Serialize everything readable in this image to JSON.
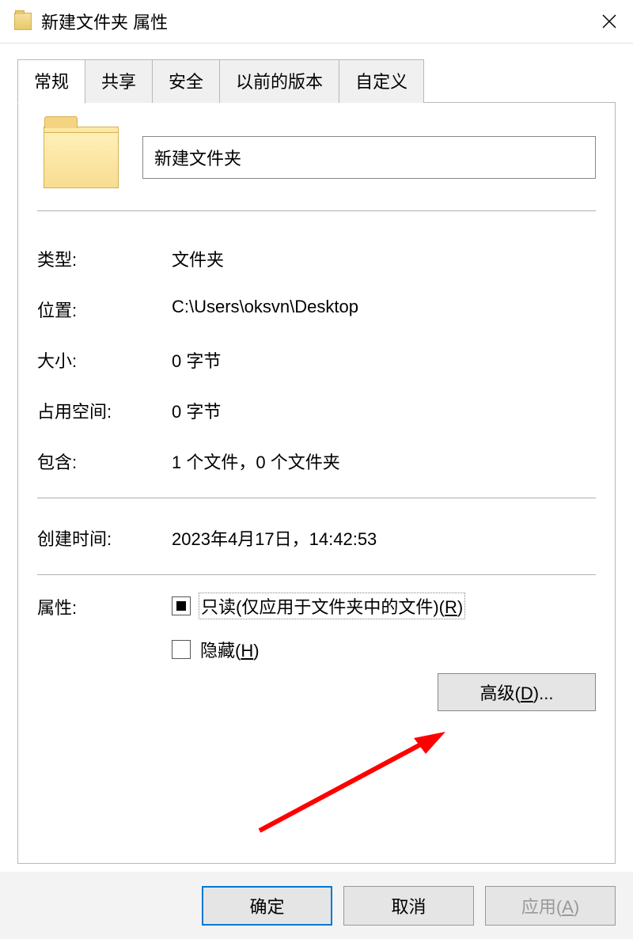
{
  "titlebar": {
    "title": "新建文件夹 属性"
  },
  "tabs": {
    "general": "常规",
    "sharing": "共享",
    "security": "安全",
    "previous_versions": "以前的版本",
    "customize": "自定义"
  },
  "general": {
    "folder_name": "新建文件夹",
    "labels": {
      "type": "类型:",
      "location": "位置:",
      "size": "大小:",
      "size_on_disk": "占用空间:",
      "contains": "包含:",
      "created": "创建时间:",
      "attributes": "属性:"
    },
    "values": {
      "type": "文件夹",
      "location": "C:\\Users\\oksvn\\Desktop",
      "size": "0 字节",
      "size_on_disk": "0 字节",
      "contains": "1 个文件，0 个文件夹",
      "created": "2023年4月17日，14:42:53"
    },
    "attributes": {
      "readonly_label": "只读(仅应用于文件夹中的文件)(R)",
      "hidden_label": "隐藏(H)"
    },
    "advanced_button": "高级(D)..."
  },
  "footer": {
    "ok": "确定",
    "cancel": "取消",
    "apply": "应用(A)"
  }
}
